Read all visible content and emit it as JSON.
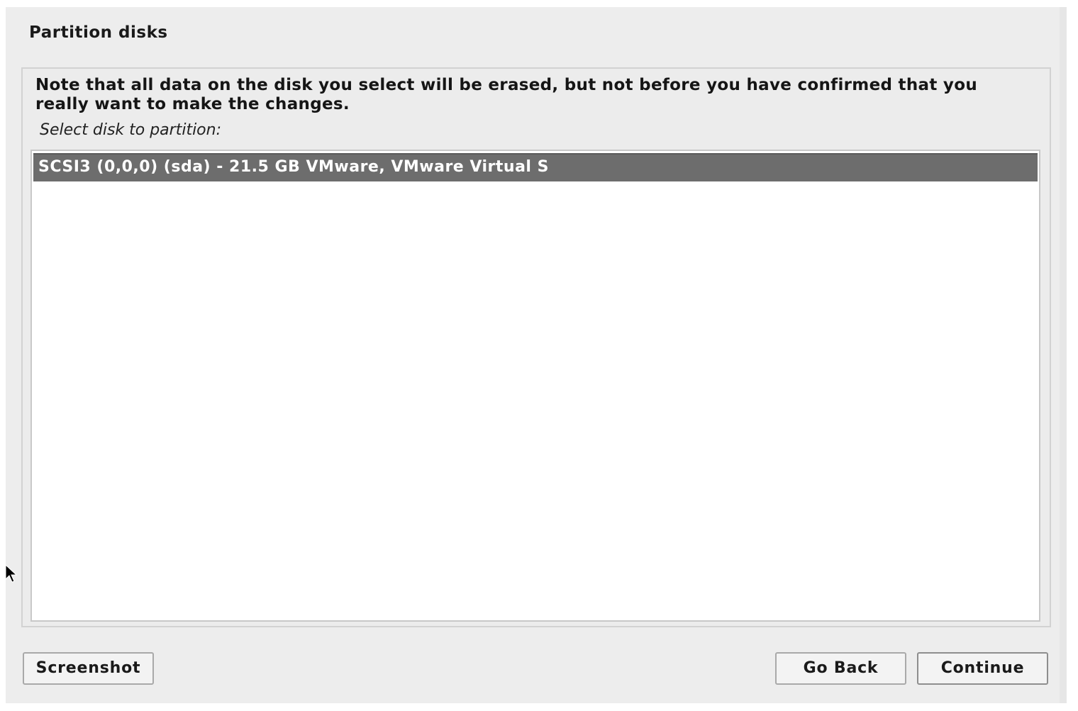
{
  "window": {
    "title": "Partition disks"
  },
  "panel": {
    "note": "Note that all data on the disk you select will be erased, but not before you have confirmed that you really want to make the changes.",
    "prompt": "Select disk to partition:",
    "disks": [
      {
        "label": "SCSI3 (0,0,0) (sda) - 21.5 GB VMware, VMware Virtual S",
        "selected": true
      }
    ]
  },
  "buttons": {
    "screenshot": "Screenshot",
    "go_back": "Go Back",
    "continue": "Continue"
  },
  "icons": {
    "cursor": "mouse-pointer-icon"
  },
  "colors": {
    "selection": "#6d6d6d",
    "background": "#ededed"
  }
}
